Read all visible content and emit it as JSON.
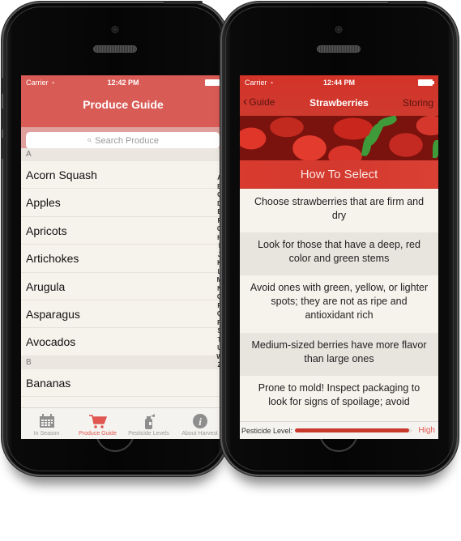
{
  "left_phone": {
    "status_bar": {
      "carrier": "Carrier",
      "time": "12:42 PM",
      "wifi_icon": "wifi-icon",
      "battery_icon": "battery-icon"
    },
    "nav": {
      "title": "Produce Guide"
    },
    "search": {
      "placeholder": "Search Produce",
      "icon": "search-icon"
    },
    "sections": [
      {
        "header": "A",
        "items": [
          "Acorn Squash",
          "Apples",
          "Apricots",
          "Artichokes",
          "Arugula",
          "Asparagus",
          "Avocados"
        ]
      },
      {
        "header": "B",
        "items": [
          "Bananas"
        ]
      }
    ],
    "index_letters": [
      "A",
      "B",
      "C",
      "D",
      "E",
      "F",
      "G",
      "H",
      "I",
      "J",
      "K",
      "L",
      "M",
      "N",
      "O",
      "P",
      "Q",
      "R",
      "S",
      "T",
      "U",
      "W",
      "Z"
    ],
    "tabs": [
      {
        "label": "In Season",
        "icon": "calendar-icon",
        "active": false
      },
      {
        "label": "Produce Guide",
        "icon": "cart-icon",
        "active": true
      },
      {
        "label": "Pesticide Levels",
        "icon": "spray-bottle-icon",
        "active": false
      },
      {
        "label": "About Harvest",
        "icon": "info-icon",
        "active": false
      }
    ]
  },
  "right_phone": {
    "status_bar": {
      "carrier": "Carrier",
      "time": "12:44 PM",
      "wifi_icon": "wifi-icon",
      "battery_icon": "battery-icon"
    },
    "nav": {
      "back_label": "Guide",
      "title": "Strawberries",
      "right_label": "Storing"
    },
    "section_title": "How To Select",
    "tips": [
      "Choose strawberries that are firm and dry",
      "Look for those that have a deep, red color and green stems",
      "Avoid ones with green, yellow, or lighter spots; they are not as ripe and antioxidant rich",
      "Medium-sized berries have more flavor than large ones",
      "Prone to mold! Inspect packaging to look for signs of spoilage; avoid"
    ],
    "pesticide": {
      "label": "Pesticide Level:",
      "level_text": "High",
      "level_fraction": 0.97
    }
  },
  "colors": {
    "left_nav": "#d95b56",
    "accent_active_tab": "#e05650",
    "right_nav": "#d9362b",
    "pesticide_bar": "#c8392b",
    "list_bg": "#f6f2ec"
  }
}
